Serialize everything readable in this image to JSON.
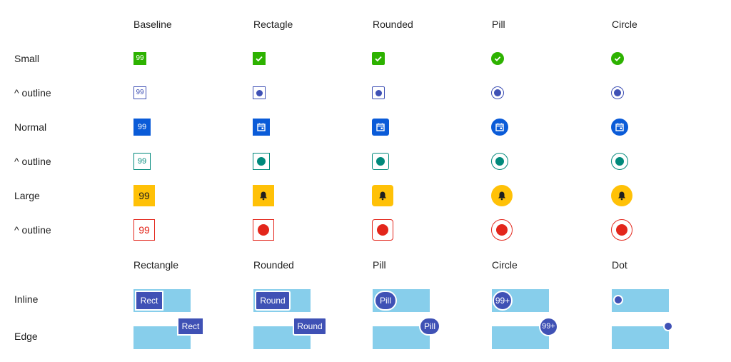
{
  "grid1": {
    "columns": [
      "Baseline",
      "Rectagle",
      "Rounded",
      "Pill",
      "Circle"
    ],
    "rows": [
      "Small",
      "^ outline",
      "Normal",
      "^ outline",
      "Large",
      "^ outline"
    ],
    "badge_text": "99"
  },
  "grid2": {
    "columns": [
      "Rectangle",
      "Rounded",
      "Pill",
      "Circle",
      "Dot"
    ],
    "rows": [
      "Inline",
      "Edge"
    ],
    "labels": {
      "rect": "Rect",
      "round": "Round",
      "pill": "Pill",
      "circle": "99+"
    }
  },
  "colors": {
    "green": "#2db200",
    "blue": "#0a5bd8",
    "indigo": "#3f51b5",
    "teal": "#00897b",
    "amber": "#ffc107",
    "red": "#e3261b",
    "chip": "#3f51b5",
    "bar": "#87ceeb"
  },
  "icons": [
    "check-icon",
    "dot-icon",
    "calendar-icon",
    "bell-icon"
  ]
}
